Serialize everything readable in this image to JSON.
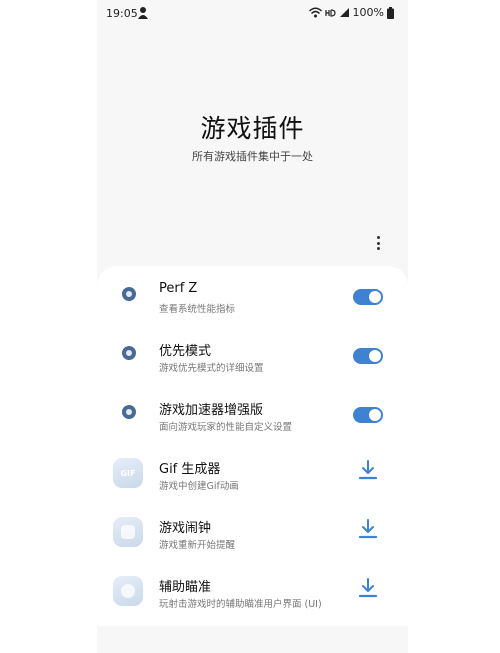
{
  "status_bar": {
    "time": "19:05",
    "battery": "100%",
    "icons": [
      "notification-icon",
      "wifi-icon",
      "hd-icon",
      "signal-icon",
      "battery-icon"
    ]
  },
  "header": {
    "title": "游戏插件",
    "subtitle": "所有游戏插件集中于一处"
  },
  "accent_color": "#3f82d1",
  "plugins": [
    {
      "title": "Perf Z",
      "desc": "查看系统性能指标",
      "control": "toggle",
      "enabled": true,
      "icon": "performance-icon"
    },
    {
      "title": "优先模式",
      "desc": "游戏优先模式的详细设置",
      "control": "toggle",
      "enabled": true,
      "icon": "priority-mode-icon"
    },
    {
      "title": "游戏加速器增强版",
      "desc": "面向游戏玩家的性能自定义设置",
      "control": "toggle",
      "enabled": true,
      "icon": "game-booster-icon"
    },
    {
      "title": "Gif 生成器",
      "desc": "游戏中创建Gif动画",
      "control": "download",
      "icon": "gif-maker-icon",
      "icon_text": "GIF"
    },
    {
      "title": "游戏闹钟",
      "desc": "游戏重新开始提醒",
      "control": "download",
      "icon": "game-alarm-icon"
    },
    {
      "title": "辅助瞄准",
      "desc": "玩射击游戏时的辅助瞄准用户界面 (UI)",
      "control": "download",
      "icon": "aim-assist-icon"
    }
  ]
}
